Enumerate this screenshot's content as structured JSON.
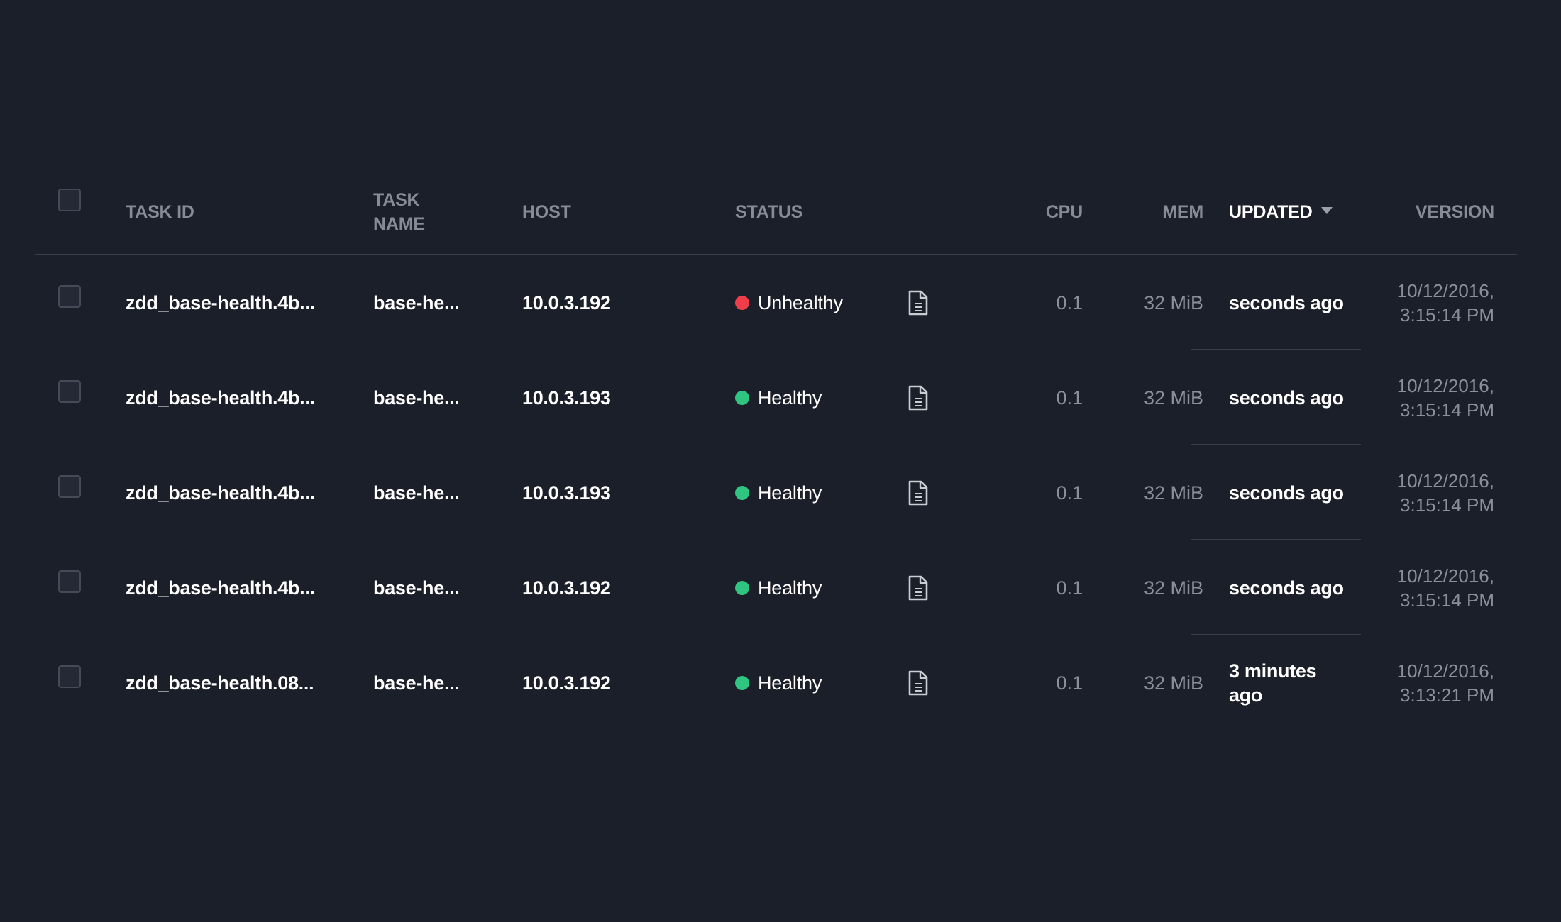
{
  "columns": {
    "task_id": "TASK ID",
    "task_name_line1": "TASK",
    "task_name_line2": "NAME",
    "host": "HOST",
    "status": "STATUS",
    "cpu": "CPU",
    "mem": "MEM",
    "updated": "UPDATED",
    "version": "VERSION"
  },
  "sort": {
    "column": "updated",
    "direction": "descending",
    "icon": "caret-down-icon"
  },
  "colors": {
    "background": "#1b1f29",
    "healthy": "#2fc480",
    "unhealthy": "#ef3e4a"
  },
  "rows": [
    {
      "task_id": "zdd_base-health.4b...",
      "task_name": "base-he...",
      "host": "10.0.3.192",
      "status": "Unhealthy",
      "status_color": "#ef3e4a",
      "cpu": "0.1",
      "mem": "32 MiB",
      "updated_line1": "seconds ago",
      "updated_line2": "",
      "version_line1": "10/12/2016,",
      "version_line2": "3:15:14 PM"
    },
    {
      "task_id": "zdd_base-health.4b...",
      "task_name": "base-he...",
      "host": "10.0.3.193",
      "status": "Healthy",
      "status_color": "#2fc480",
      "cpu": "0.1",
      "mem": "32 MiB",
      "updated_line1": "seconds ago",
      "updated_line2": "",
      "version_line1": "10/12/2016,",
      "version_line2": "3:15:14 PM"
    },
    {
      "task_id": "zdd_base-health.4b...",
      "task_name": "base-he...",
      "host": "10.0.3.193",
      "status": "Healthy",
      "status_color": "#2fc480",
      "cpu": "0.1",
      "mem": "32 MiB",
      "updated_line1": "seconds ago",
      "updated_line2": "",
      "version_line1": "10/12/2016,",
      "version_line2": "3:15:14 PM"
    },
    {
      "task_id": "zdd_base-health.4b...",
      "task_name": "base-he...",
      "host": "10.0.3.192",
      "status": "Healthy",
      "status_color": "#2fc480",
      "cpu": "0.1",
      "mem": "32 MiB",
      "updated_line1": "seconds ago",
      "updated_line2": "",
      "version_line1": "10/12/2016,",
      "version_line2": "3:15:14 PM"
    },
    {
      "task_id": "zdd_base-health.08...",
      "task_name": "base-he...",
      "host": "10.0.3.192",
      "status": "Healthy",
      "status_color": "#2fc480",
      "cpu": "0.1",
      "mem": "32 MiB",
      "updated_line1": "3 minutes",
      "updated_line2": "ago",
      "version_line1": "10/12/2016,",
      "version_line2": "3:13:21 PM"
    }
  ],
  "row_icons": {
    "log": "file-document-icon"
  }
}
